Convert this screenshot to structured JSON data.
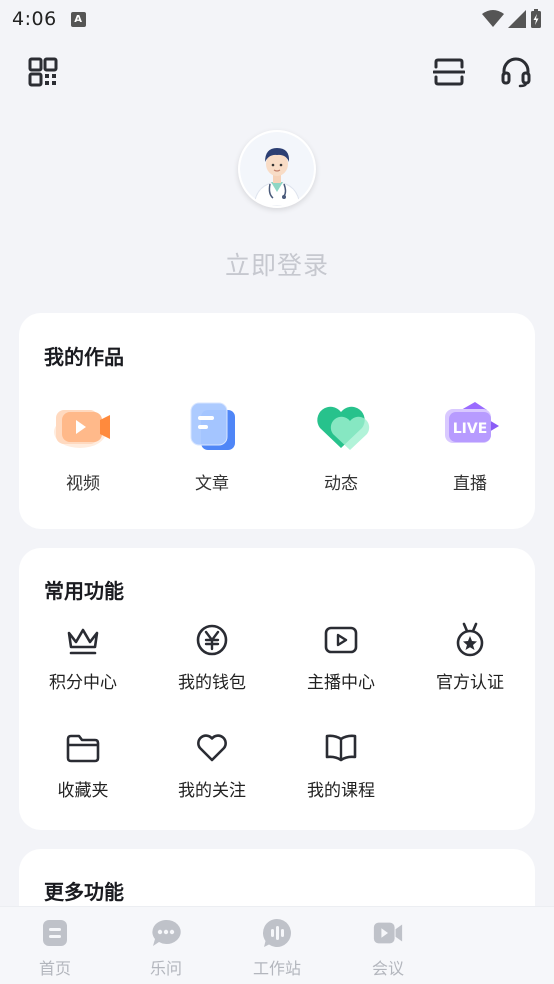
{
  "status_bar": {
    "time": "4:06",
    "a_badge": "A"
  },
  "top_bar": {
    "left_icon": "qr-code-icon",
    "scan_icon": "scan-icon",
    "service_icon": "headset-icon"
  },
  "profile": {
    "login_text": "立即登录"
  },
  "works": {
    "title": "我的作品",
    "items": [
      {
        "label": "视频",
        "icon": "video-icon"
      },
      {
        "label": "文章",
        "icon": "article-icon"
      },
      {
        "label": "动态",
        "icon": "heart-icon"
      },
      {
        "label": "直播",
        "icon": "live-icon",
        "badge": "LIVE"
      }
    ]
  },
  "common": {
    "title": "常用功能",
    "items": [
      {
        "label": "积分中心",
        "icon": "crown-icon"
      },
      {
        "label": "我的钱包",
        "icon": "yuan-icon"
      },
      {
        "label": "主播中心",
        "icon": "play-icon"
      },
      {
        "label": "官方认证",
        "icon": "medal-icon"
      },
      {
        "label": "收藏夹",
        "icon": "folder-icon"
      },
      {
        "label": "我的关注",
        "icon": "heart-outline-icon"
      },
      {
        "label": "我的课程",
        "icon": "book-icon"
      }
    ]
  },
  "more": {
    "title": "更多功能"
  },
  "bottom_nav": [
    {
      "label": "首页",
      "icon": "home-icon"
    },
    {
      "label": "乐问",
      "icon": "chat-icon"
    },
    {
      "label": "工作站",
      "icon": "workstation-icon"
    },
    {
      "label": "会议",
      "icon": "meeting-icon"
    }
  ],
  "colors": {
    "background": "#f3f4f8",
    "nav_inactive": "#b3b6bd",
    "login_text": "#c6c8cf"
  }
}
